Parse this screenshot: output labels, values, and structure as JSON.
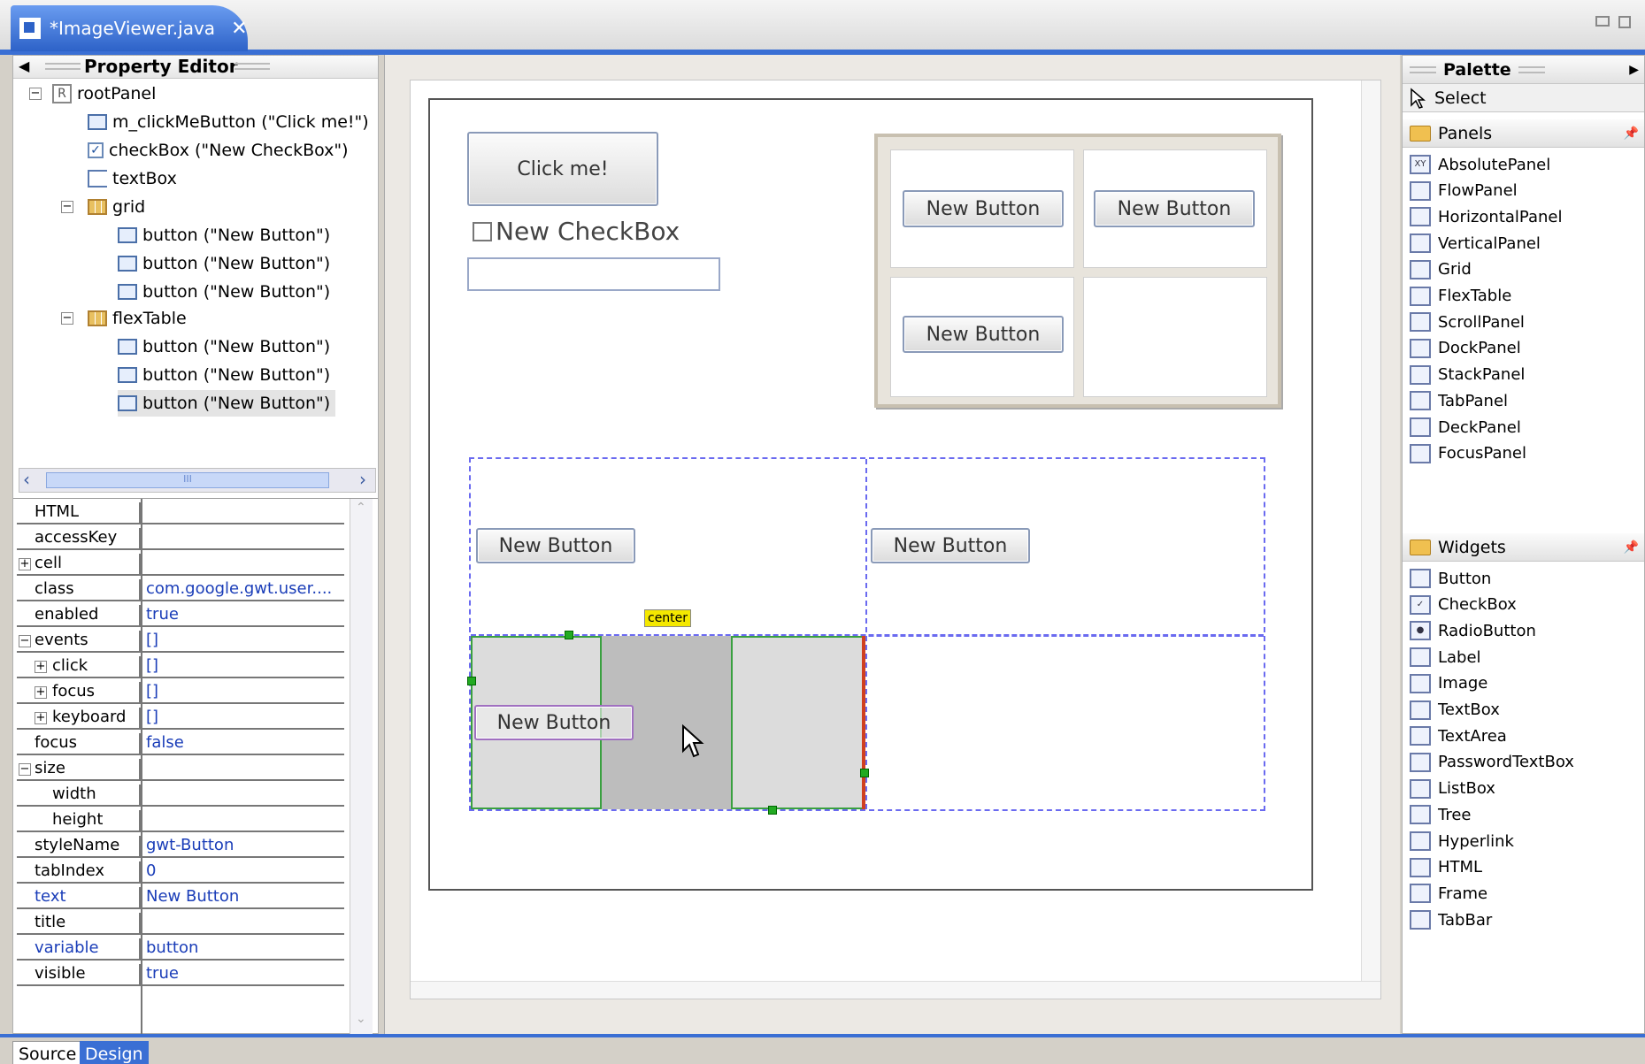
{
  "editor": {
    "tab_title": "*ImageViewer.java",
    "close": "✕"
  },
  "property_editor": {
    "title": "Property Editor",
    "tree": [
      {
        "label": "rootPanel",
        "icon": "R",
        "kind": "root"
      },
      {
        "label": "m_clickMeButton (\"Click me!\")",
        "kind": "button"
      },
      {
        "label": "checkBox (\"New CheckBox\")",
        "kind": "checkbox"
      },
      {
        "label": "textBox",
        "kind": "textbox"
      },
      {
        "label": "grid",
        "kind": "grid"
      },
      {
        "label": "button (\"New Button\")",
        "kind": "button"
      },
      {
        "label": "button (\"New Button\")",
        "kind": "button"
      },
      {
        "label": "button (\"New Button\")",
        "kind": "button"
      },
      {
        "label": "flexTable",
        "kind": "grid"
      },
      {
        "label": "button (\"New Button\")",
        "kind": "button"
      },
      {
        "label": "button (\"New Button\")",
        "kind": "button"
      },
      {
        "label": "button (\"New Button\")",
        "kind": "button"
      }
    ],
    "scroll_grip": "III",
    "properties": [
      {
        "name": "HTML",
        "value": ""
      },
      {
        "name": "accessKey",
        "value": ""
      },
      {
        "name": "cell",
        "value": "",
        "expander": "+"
      },
      {
        "name": "class",
        "value": "com.google.gwt.user...."
      },
      {
        "name": "enabled",
        "value": "true"
      },
      {
        "name": "events",
        "value": "[]",
        "expander": "−"
      },
      {
        "name": "click",
        "value": "[]",
        "expander": "+",
        "indent": true
      },
      {
        "name": "focus",
        "value": "[]",
        "expander": "+",
        "indent": true
      },
      {
        "name": "keyboard",
        "value": "[]",
        "expander": "+",
        "indent": true
      },
      {
        "name": "focus",
        "value": "false"
      },
      {
        "name": "size",
        "value": "",
        "expander": "−"
      },
      {
        "name": "width",
        "value": "",
        "indent": true
      },
      {
        "name": "height",
        "value": "",
        "indent": true
      },
      {
        "name": "styleName",
        "value": "gwt-Button"
      },
      {
        "name": "tabIndex",
        "value": "0"
      },
      {
        "name": "text",
        "value": "New Button",
        "highlight": true
      },
      {
        "name": "title",
        "value": ""
      },
      {
        "name": "variable",
        "value": "button",
        "highlight": true
      },
      {
        "name": "visible",
        "value": "true"
      }
    ]
  },
  "design": {
    "click_me": "Click me!",
    "checkbox": "New CheckBox",
    "grid_buttons": [
      "New Button",
      "New Button",
      "New Button"
    ],
    "flex_buttons": [
      "New Button",
      "New Button",
      "New Button"
    ],
    "center_tag": "center"
  },
  "palette": {
    "title": "Palette",
    "select": "Select",
    "panels_title": "Panels",
    "panels": [
      {
        "label": "AbsolutePanel",
        "icon": "XY"
      },
      {
        "label": "FlowPanel",
        "icon": ""
      },
      {
        "label": "HorizontalPanel",
        "icon": ""
      },
      {
        "label": "VerticalPanel",
        "icon": ""
      },
      {
        "label": "Grid",
        "icon": ""
      },
      {
        "label": "FlexTable",
        "icon": ""
      },
      {
        "label": "ScrollPanel",
        "icon": ""
      },
      {
        "label": "DockPanel",
        "icon": ""
      },
      {
        "label": "StackPanel",
        "icon": ""
      },
      {
        "label": "TabPanel",
        "icon": ""
      },
      {
        "label": "DeckPanel",
        "icon": ""
      },
      {
        "label": "FocusPanel",
        "icon": ""
      }
    ],
    "widgets_title": "Widgets",
    "widgets": [
      {
        "label": "Button",
        "icon": ""
      },
      {
        "label": "CheckBox",
        "icon": "✓"
      },
      {
        "label": "RadioButton",
        "icon": "●"
      },
      {
        "label": "Label",
        "icon": ""
      },
      {
        "label": "Image",
        "icon": ""
      },
      {
        "label": "TextBox",
        "icon": ""
      },
      {
        "label": "TextArea",
        "icon": ""
      },
      {
        "label": "PasswordTextBox",
        "icon": ""
      },
      {
        "label": "ListBox",
        "icon": ""
      },
      {
        "label": "Tree",
        "icon": ""
      },
      {
        "label": "Hyperlink",
        "icon": ""
      },
      {
        "label": "HTML",
        "icon": ""
      },
      {
        "label": "Frame",
        "icon": ""
      },
      {
        "label": "TabBar",
        "icon": ""
      }
    ]
  },
  "bottom_tabs": [
    "Source",
    "Design"
  ]
}
